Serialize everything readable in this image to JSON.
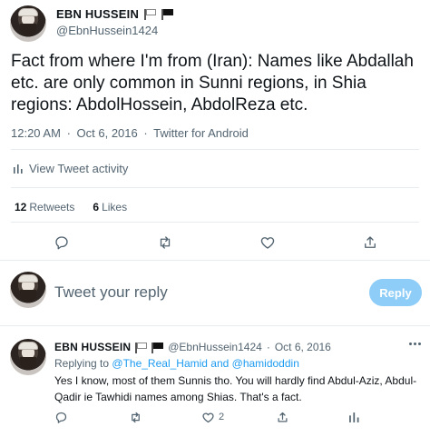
{
  "tweet": {
    "display_name": "EBN HUSSEIN",
    "handle": "@EbnHussein1424",
    "text": "Fact from where I'm from (Iran): Names like Abdallah etc. are only common in Sunni regions, in Shia regions: AbdolHossein, AbdolReza etc.",
    "time": "12:20 AM",
    "date": "Oct 6, 2016",
    "meta_sep": "·",
    "client": "Twitter for Android",
    "activity_label": "View Tweet activity",
    "retweets_count": "12",
    "retweets_label": "Retweets",
    "likes_count": "6",
    "likes_label": "Likes"
  },
  "composer": {
    "placeholder": "Tweet your reply",
    "button_label": "Reply"
  },
  "reply": {
    "display_name": "EBN HUSSEIN",
    "handle": "@EbnHussein1424",
    "dot": "·",
    "date": "Oct 6, 2016",
    "replying_prefix": "Replying to",
    "replying_targets": "@The_Real_Hamid and @hamidoddin",
    "text": "Yes I know, most of them Sunnis tho. You will hardly find Abdul-Aziz, Abdul-Qadir ie Tawhidi names among Shias. That's a fact.",
    "like_count": "2"
  },
  "icons": {
    "reply": "reply-icon",
    "retweet": "retweet-icon",
    "like": "heart-icon",
    "share": "share-icon",
    "analytics": "analytics-icon",
    "more": "more-icon"
  },
  "colors": {
    "accent": "#1d9bf0",
    "reply_button_disabled": "#8ecdf8",
    "secondary_text": "#536471"
  }
}
